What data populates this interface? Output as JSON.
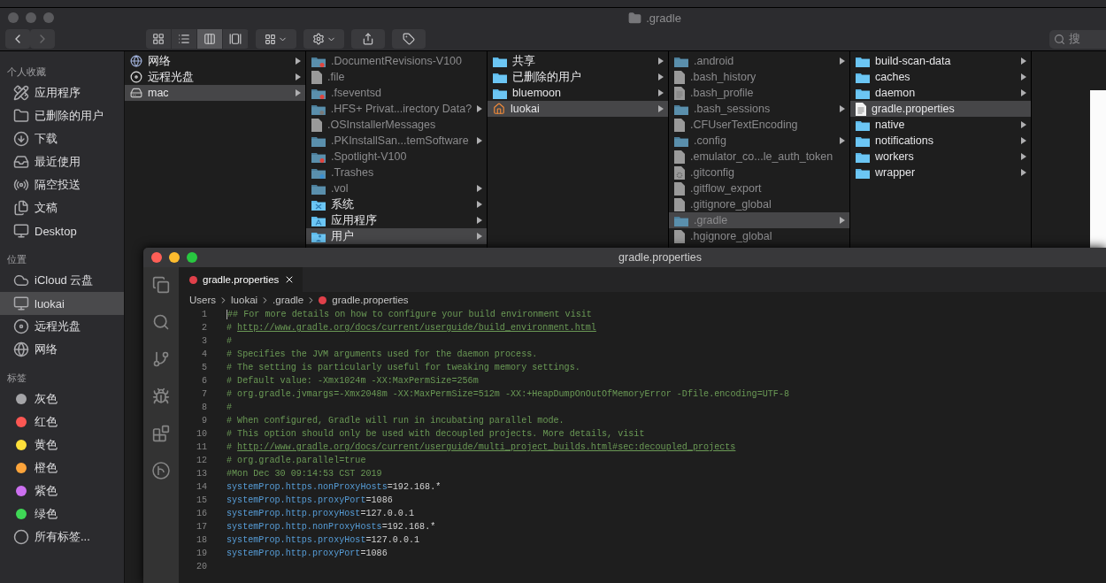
{
  "finder": {
    "title": ".gradle",
    "toolbar": {
      "view_modes": [
        {
          "kind": "icons",
          "selected": false
        },
        {
          "kind": "list",
          "selected": false
        },
        {
          "kind": "columns",
          "selected": true
        },
        {
          "kind": "gallery",
          "selected": false
        }
      ]
    },
    "search": {
      "placeholder": "搜"
    },
    "sidebar": {
      "sections": [
        {
          "title": "个人收藏",
          "items": [
            {
              "label": "应用程序",
              "kind": "apps",
              "selected": false
            },
            {
              "label": "已删除的用户",
              "kind": "folder",
              "selected": false
            },
            {
              "label": "下载",
              "kind": "download",
              "selected": false
            },
            {
              "label": "最近使用",
              "kind": "recent",
              "selected": false
            },
            {
              "label": "隔空投送",
              "kind": "airdrop",
              "selected": false
            },
            {
              "label": "文稿",
              "kind": "document",
              "selected": false
            },
            {
              "label": "Desktop",
              "kind": "desktop",
              "selected": false
            }
          ]
        },
        {
          "title": "位置",
          "items": [
            {
              "label": "iCloud 云盘",
              "kind": "cloud",
              "selected": false
            },
            {
              "label": "luokai",
              "kind": "computer",
              "selected": true
            },
            {
              "label": "远程光盘",
              "kind": "disc",
              "selected": false
            },
            {
              "label": "网络",
              "kind": "network",
              "selected": false
            }
          ]
        },
        {
          "title": "标签",
          "items": [
            {
              "label": "灰色",
              "kind": "tag",
              "color": "#a5a5a8",
              "selected": false
            },
            {
              "label": "红色",
              "kind": "tag",
              "color": "#fc5753",
              "selected": false
            },
            {
              "label": "黄色",
              "kind": "tag",
              "color": "#fddf3a",
              "selected": false
            },
            {
              "label": "橙色",
              "kind": "tag",
              "color": "#fda43b",
              "selected": false
            },
            {
              "label": "紫色",
              "kind": "tag",
              "color": "#cc70f0",
              "selected": false
            },
            {
              "label": "绿色",
              "kind": "tag",
              "color": "#3fd756",
              "selected": false
            },
            {
              "label": "所有标签...",
              "kind": "all-tags",
              "selected": false
            }
          ]
        }
      ]
    },
    "columns": [
      {
        "items": [
          {
            "label": "网络",
            "kind": "network",
            "has_children": true,
            "dimmed": false,
            "selected": false
          },
          {
            "label": "远程光盘",
            "kind": "disc",
            "has_children": true,
            "dimmed": false,
            "selected": false
          },
          {
            "label": "mac",
            "kind": "drive",
            "has_children": true,
            "dimmed": false,
            "selected": true
          }
        ]
      },
      {
        "items": [
          {
            "label": ".DocumentRevisions-V100",
            "kind": "restricted-folder",
            "has_children": false,
            "dimmed": true,
            "selected": false
          },
          {
            "label": ".file",
            "kind": "file",
            "has_children": false,
            "dimmed": true,
            "selected": false
          },
          {
            "label": ".fseventsd",
            "kind": "restricted-folder",
            "has_children": false,
            "dimmed": true,
            "selected": false
          },
          {
            "label": ".HFS+ Privat...irectory Data?",
            "kind": "locked-folder",
            "has_children": true,
            "dimmed": true,
            "selected": false
          },
          {
            "label": ".OSInstallerMessages",
            "kind": "file",
            "has_children": false,
            "dimmed": true,
            "selected": false
          },
          {
            "label": ".PKInstallSan...temSoftware",
            "kind": "folder",
            "has_children": true,
            "dimmed": true,
            "selected": false
          },
          {
            "label": ".Spotlight-V100",
            "kind": "restricted-folder",
            "has_children": false,
            "dimmed": true,
            "selected": false
          },
          {
            "label": ".Trashes",
            "kind": "download-folder",
            "has_children": false,
            "dimmed": true,
            "selected": false
          },
          {
            "label": ".vol",
            "kind": "folder",
            "has_children": true,
            "dimmed": true,
            "selected": false
          },
          {
            "label": "系统",
            "kind": "system-folder",
            "has_children": true,
            "dimmed": false,
            "selected": false
          },
          {
            "label": "应用程序",
            "kind": "apps-folder",
            "has_children": true,
            "dimmed": false,
            "selected": false
          },
          {
            "label": "用户",
            "kind": "users-folder",
            "has_children": true,
            "dimmed": false,
            "selected": true
          }
        ]
      },
      {
        "items": [
          {
            "label": "共享",
            "kind": "folder",
            "has_children": true,
            "dimmed": false,
            "selected": false
          },
          {
            "label": "已删除的用户",
            "kind": "folder",
            "has_children": true,
            "dimmed": false,
            "selected": false
          },
          {
            "label": "bluemoon",
            "kind": "folder",
            "has_children": true,
            "dimmed": false,
            "selected": false
          },
          {
            "label": "luokai",
            "kind": "home",
            "has_children": true,
            "dimmed": false,
            "selected": true
          }
        ]
      },
      {
        "items": [
          {
            "label": ".android",
            "kind": "folder",
            "has_children": true,
            "dimmed": true,
            "selected": false
          },
          {
            "label": ".bash_history",
            "kind": "file",
            "has_children": false,
            "dimmed": true,
            "selected": false
          },
          {
            "label": ".bash_profile",
            "kind": "text-file",
            "has_children": false,
            "dimmed": true,
            "selected": false
          },
          {
            "label": ".bash_sessions",
            "kind": "folder",
            "has_children": true,
            "dimmed": true,
            "selected": false
          },
          {
            "label": ".CFUserTextEncoding",
            "kind": "file",
            "has_children": false,
            "dimmed": true,
            "selected": false
          },
          {
            "label": ".config",
            "kind": "folder",
            "has_children": true,
            "dimmed": true,
            "selected": false
          },
          {
            "label": ".emulator_co...le_auth_token",
            "kind": "file",
            "has_children": false,
            "dimmed": true,
            "selected": false
          },
          {
            "label": ".gitconfig",
            "kind": "gear-file",
            "has_children": false,
            "dimmed": true,
            "selected": false
          },
          {
            "label": ".gitflow_export",
            "kind": "file",
            "has_children": false,
            "dimmed": true,
            "selected": false
          },
          {
            "label": ".gitignore_global",
            "kind": "file",
            "has_children": false,
            "dimmed": true,
            "selected": false
          },
          {
            "label": ".gradle",
            "kind": "folder",
            "has_children": true,
            "dimmed": true,
            "selected": true
          },
          {
            "label": ".hgignore_global",
            "kind": "file",
            "has_children": false,
            "dimmed": true,
            "selected": false
          }
        ]
      },
      {
        "items": [
          {
            "label": "build-scan-data",
            "kind": "folder",
            "has_children": true,
            "dimmed": false,
            "selected": false
          },
          {
            "label": "caches",
            "kind": "folder",
            "has_children": true,
            "dimmed": false,
            "selected": false
          },
          {
            "label": "daemon",
            "kind": "folder",
            "has_children": true,
            "dimmed": false,
            "selected": false
          },
          {
            "label": "gradle.properties",
            "kind": "text-file",
            "has_children": false,
            "dimmed": false,
            "selected": true
          },
          {
            "label": "native",
            "kind": "folder",
            "has_children": true,
            "dimmed": false,
            "selected": false
          },
          {
            "label": "notifications",
            "kind": "folder",
            "has_children": true,
            "dimmed": false,
            "selected": false
          },
          {
            "label": "workers",
            "kind": "folder",
            "has_children": true,
            "dimmed": false,
            "selected": false
          },
          {
            "label": "wrapper",
            "kind": "folder",
            "has_children": true,
            "dimmed": false,
            "selected": false
          }
        ]
      }
    ]
  },
  "editor": {
    "title": "gradle.properties",
    "tabs": [
      {
        "label": "gradle.properties",
        "selected": true
      }
    ],
    "breadcrumbs": [
      "Users",
      "luokai",
      ".gradle",
      "gradle.properties"
    ],
    "lines": [
      {
        "number": "1",
        "kind": "comment",
        "text": "## For more details on how to configure your build environment visit",
        "cursor": true
      },
      {
        "number": "2",
        "kind": "link",
        "text": "#",
        "link": "http://www.gradle.org/docs/current/userguide/build_environment.html"
      },
      {
        "number": "3",
        "kind": "comment",
        "text": "#"
      },
      {
        "number": "4",
        "kind": "comment",
        "text": "# Specifies the JVM arguments used for the daemon process."
      },
      {
        "number": "5",
        "kind": "comment",
        "text": "# The setting is particularly useful for tweaking memory settings."
      },
      {
        "number": "6",
        "kind": "comment",
        "text": "# Default value: -Xmx1024m -XX:MaxPermSize=256m"
      },
      {
        "number": "7",
        "kind": "comment",
        "text": "# org.gradle.jvmargs=-Xmx2048m -XX:MaxPermSize=512m -XX:+HeapDumpOnOutOfMemoryError -Dfile.encoding=UTF-8"
      },
      {
        "number": "8",
        "kind": "comment",
        "text": "#"
      },
      {
        "number": "9",
        "kind": "comment",
        "text": "# When configured, Gradle will run in incubating parallel mode."
      },
      {
        "number": "10",
        "kind": "comment",
        "text": "# This option should only be used with decoupled projects. More details, visit"
      },
      {
        "number": "11",
        "kind": "link",
        "text": "#",
        "link": "http://www.gradle.org/docs/current/userguide/multi_project_builds.html#sec:decoupled_projects"
      },
      {
        "number": "12",
        "kind": "comment",
        "text": "# org.gradle.parallel=true"
      },
      {
        "number": "13",
        "kind": "comment",
        "text": "#Mon Dec 30 09:14:53 CST 2019"
      },
      {
        "number": "14",
        "kind": "property",
        "key": "systemProp.https.nonProxyHosts",
        "value": "=192.168.*"
      },
      {
        "number": "15",
        "kind": "property",
        "key": "systemProp.https.proxyPort",
        "value": "=1086"
      },
      {
        "number": "16",
        "kind": "property",
        "key": "systemProp.http.proxyHost",
        "value": "=127.0.0.1"
      },
      {
        "number": "17",
        "kind": "property",
        "key": "systemProp.http.nonProxyHosts",
        "value": "=192.168.*"
      },
      {
        "number": "18",
        "kind": "property",
        "key": "systemProp.https.proxyHost",
        "value": "=127.0.0.1"
      },
      {
        "number": "19",
        "kind": "property",
        "key": "systemProp.http.proxyPort",
        "value": "=1086"
      },
      {
        "number": "20",
        "kind": "blank"
      }
    ]
  }
}
